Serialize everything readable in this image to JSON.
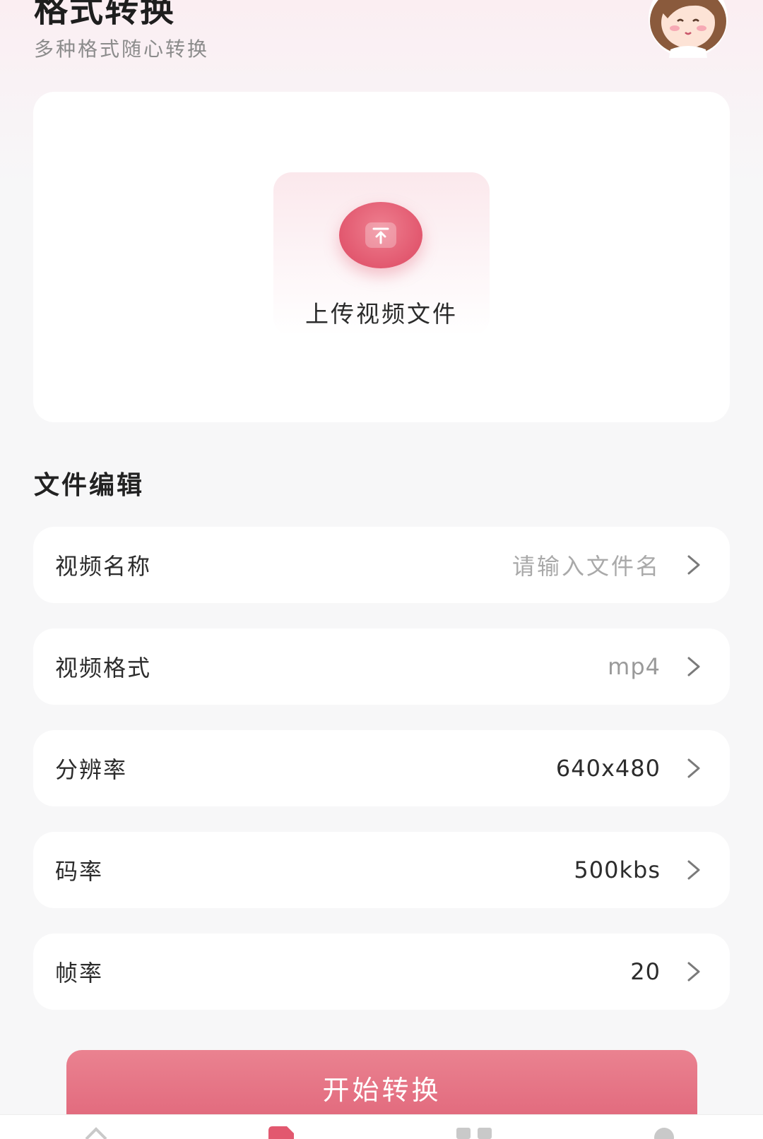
{
  "header": {
    "title": "格式转换",
    "subtitle": "多种格式随心转换",
    "avatar": "girl-avatar-icon"
  },
  "upload": {
    "label": "上传视频文件",
    "icon": "upload-arrow-icon"
  },
  "section": {
    "title": "文件编辑"
  },
  "fields": [
    {
      "label": "视频名称",
      "value": "请输入文件名",
      "is_placeholder": true
    },
    {
      "label": "视频格式",
      "value": "mp4"
    },
    {
      "label": "分辨率",
      "value": "640x480"
    },
    {
      "label": "码率",
      "value": "500kbs"
    },
    {
      "label": "帧率",
      "value": "20"
    }
  ],
  "actions": {
    "start_label": "开始转换"
  },
  "tabbar": {
    "icons": [
      "home-icon",
      "convert-icon",
      "tools-icon",
      "profile-icon"
    ],
    "active_index": 1
  },
  "colors": {
    "accent": "#e2586f",
    "background": "#f7f7f8",
    "card": "#ffffff"
  }
}
